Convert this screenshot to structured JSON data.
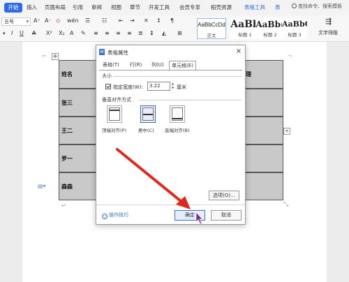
{
  "ribbon": {
    "tabs": [
      "开始",
      "插入",
      "页面布局",
      "引用",
      "审阅",
      "视图",
      "章节",
      "开发工具",
      "会员专享",
      "稻壳资源",
      "表格工具",
      "表"
    ],
    "search_label": "查找命令、搜索模板",
    "font_size": "五号",
    "styles": [
      {
        "preview": "AaBbCcDd",
        "caption": "正文"
      },
      {
        "preview": "AaBb",
        "caption": "标题 1"
      },
      {
        "preview": "AaBb(",
        "caption": "标题 2"
      },
      {
        "preview": "AaBbC",
        "caption": "标题 3"
      }
    ],
    "text_layout": "文字排版"
  },
  "doc_table": {
    "row_labels": [
      "姓名",
      "张三",
      "王二",
      "罗一",
      "森森"
    ],
    "right_label": "理",
    "paragraph_mark": "↵"
  },
  "dialog": {
    "title": "表格属性",
    "close": "×",
    "tabs": [
      "表格(T)",
      "行(R)",
      "列(U)",
      "单元格(E)"
    ],
    "size_group": "大小",
    "width_checkbox_label": "指定宽度(W):",
    "width_value": "3.22",
    "unit": "厘米",
    "valign_group": "垂直对齐方式",
    "align_options": [
      "顶端对齐(P)",
      "居中(C)",
      "底端对齐(B)"
    ],
    "selected_align": "居中(C)",
    "options_button": "选项(O)...",
    "tips": "操作技巧",
    "ok": "确定",
    "cancel": "取消"
  },
  "colors": {
    "accent": "#2e6be6",
    "arrow": "#e0281e",
    "cell_shade": "#c9c9c9"
  }
}
